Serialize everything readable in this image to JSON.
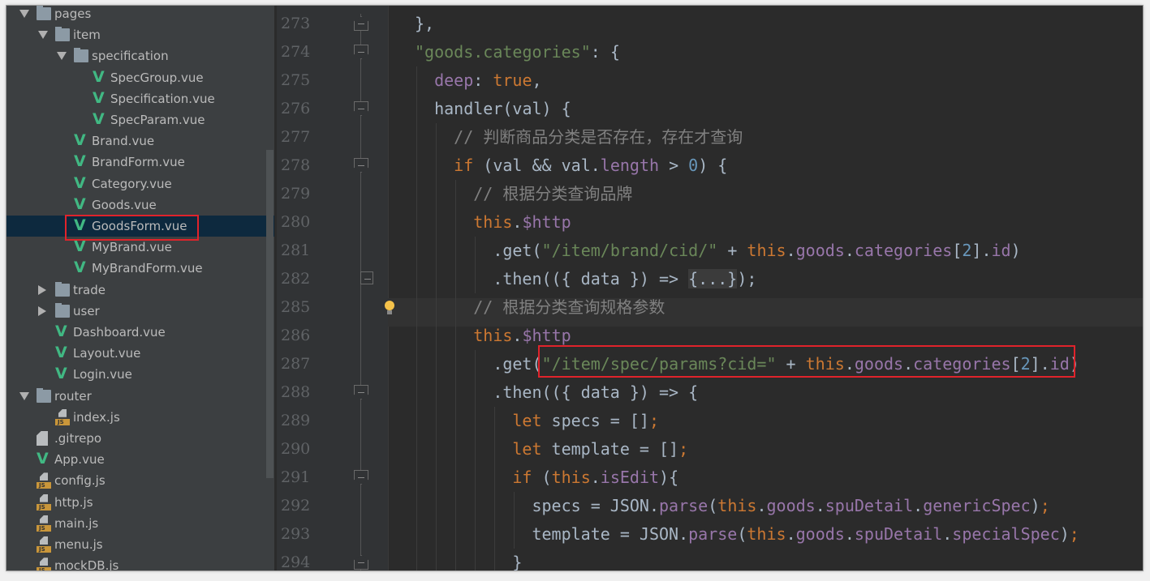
{
  "tree": [
    {
      "name": "pages",
      "type": "folder",
      "depth": 0,
      "expanded": true
    },
    {
      "name": "item",
      "type": "folder",
      "depth": 1,
      "expanded": true
    },
    {
      "name": "specification",
      "type": "folder",
      "depth": 2,
      "expanded": true
    },
    {
      "name": "SpecGroup.vue",
      "type": "vue",
      "depth": 3
    },
    {
      "name": "Specification.vue",
      "type": "vue",
      "depth": 3
    },
    {
      "name": "SpecParam.vue",
      "type": "vue",
      "depth": 3
    },
    {
      "name": "Brand.vue",
      "type": "vue",
      "depth": 2
    },
    {
      "name": "BrandForm.vue",
      "type": "vue",
      "depth": 2
    },
    {
      "name": "Category.vue",
      "type": "vue",
      "depth": 2
    },
    {
      "name": "Goods.vue",
      "type": "vue",
      "depth": 2
    },
    {
      "name": "GoodsForm.vue",
      "type": "vue",
      "depth": 2,
      "selected": true,
      "highlighted": true
    },
    {
      "name": "MyBrand.vue",
      "type": "vue",
      "depth": 2
    },
    {
      "name": "MyBrandForm.vue",
      "type": "vue",
      "depth": 2
    },
    {
      "name": "trade",
      "type": "folder",
      "depth": 1,
      "expanded": false
    },
    {
      "name": "user",
      "type": "folder",
      "depth": 1,
      "expanded": false
    },
    {
      "name": "Dashboard.vue",
      "type": "vue",
      "depth": 1
    },
    {
      "name": "Layout.vue",
      "type": "vue",
      "depth": 1
    },
    {
      "name": "Login.vue",
      "type": "vue",
      "depth": 1
    },
    {
      "name": "router",
      "type": "folder",
      "depth": 0,
      "expanded": true
    },
    {
      "name": "index.js",
      "type": "js",
      "depth": 1
    },
    {
      "name": ".gitrepo",
      "type": "text",
      "depth": 0
    },
    {
      "name": "App.vue",
      "type": "vue",
      "depth": 0
    },
    {
      "name": "config.js",
      "type": "js",
      "depth": 0
    },
    {
      "name": "http.js",
      "type": "js",
      "depth": 0
    },
    {
      "name": "main.js",
      "type": "js",
      "depth": 0
    },
    {
      "name": "menu.js",
      "type": "js",
      "depth": 0
    },
    {
      "name": "mockDB.js",
      "type": "js",
      "depth": 0
    }
  ],
  "js_badge": "JS",
  "highlight_color": "#e0232b",
  "code": [
    {
      "num": "273",
      "indent": 0,
      "fold": "end",
      "tokens": [
        [
          "t",
          "},"
        ]
      ]
    },
    {
      "num": "274",
      "indent": 0,
      "fold": "start",
      "tokens": [
        [
          "s",
          "\"goods.categories\""
        ],
        [
          "t",
          ": {"
        ]
      ]
    },
    {
      "num": "275",
      "indent": 2,
      "tokens": [
        [
          "p",
          "deep"
        ],
        [
          "t",
          ": "
        ],
        [
          "k",
          "true"
        ],
        [
          "t",
          ","
        ]
      ]
    },
    {
      "num": "276",
      "indent": 2,
      "fold": "start",
      "tokens": [
        [
          "t",
          "handler(val) {"
        ]
      ]
    },
    {
      "num": "277",
      "indent": 4,
      "tokens": [
        [
          "c",
          "// 判断商品分类是否存在，存在才查询"
        ]
      ]
    },
    {
      "num": "278",
      "indent": 4,
      "fold": "start",
      "tokens": [
        [
          "k",
          "if"
        ],
        [
          "t",
          " (val && val."
        ],
        [
          "p",
          "length"
        ],
        [
          "t",
          " > "
        ],
        [
          "n",
          "0"
        ],
        [
          "t",
          ") {"
        ]
      ]
    },
    {
      "num": "279",
      "indent": 6,
      "tokens": [
        [
          "c",
          "// 根据分类查询品牌"
        ]
      ]
    },
    {
      "num": "280",
      "indent": 6,
      "tokens": [
        [
          "k",
          "this"
        ],
        [
          "t",
          "."
        ],
        [
          "p",
          "$http"
        ]
      ]
    },
    {
      "num": "281",
      "indent": 8,
      "tokens": [
        [
          "t",
          ".get("
        ],
        [
          "s",
          "\"/item/brand/cid/\""
        ],
        [
          "t",
          " + "
        ],
        [
          "k",
          "this"
        ],
        [
          "t",
          "."
        ],
        [
          "p",
          "goods"
        ],
        [
          "t",
          "."
        ],
        [
          "p",
          "categories"
        ],
        [
          "t",
          "["
        ],
        [
          "n",
          "2"
        ],
        [
          "t",
          "]."
        ],
        [
          "p",
          "id"
        ],
        [
          "t",
          ")"
        ]
      ]
    },
    {
      "num": "282",
      "indent": 8,
      "fold": "collapsed",
      "tokens": [
        [
          "t",
          ".then(({ data }) => "
        ],
        [
          "fd",
          "{...}"
        ],
        [
          "t",
          ");"
        ]
      ]
    },
    {
      "num": "285",
      "indent": 6,
      "current": true,
      "tokens": [
        [
          "c",
          "// 根据分类查询规格参数"
        ]
      ]
    },
    {
      "num": "286",
      "indent": 6,
      "tokens": [
        [
          "k",
          "this"
        ],
        [
          "t",
          "."
        ],
        [
          "p",
          "$http"
        ]
      ]
    },
    {
      "num": "287",
      "indent": 8,
      "highlighted": true,
      "tokens": [
        [
          "t",
          ".get("
        ],
        [
          "s",
          "\"/item/spec/params?cid=\""
        ],
        [
          "t",
          " + "
        ],
        [
          "k",
          "this"
        ],
        [
          "t",
          "."
        ],
        [
          "p",
          "goods"
        ],
        [
          "t",
          "."
        ],
        [
          "p",
          "categories"
        ],
        [
          "t",
          "["
        ],
        [
          "n",
          "2"
        ],
        [
          "t",
          "]."
        ],
        [
          "p",
          "id"
        ],
        [
          "t",
          ")"
        ]
      ]
    },
    {
      "num": "288",
      "indent": 8,
      "fold": "start",
      "tokens": [
        [
          "t",
          ".then(({ data }) => {"
        ]
      ]
    },
    {
      "num": "289",
      "indent": 10,
      "tokens": [
        [
          "k",
          "let"
        ],
        [
          "t",
          " specs = []"
        ],
        [
          "k",
          ";"
        ]
      ]
    },
    {
      "num": "290",
      "indent": 10,
      "tokens": [
        [
          "k",
          "let"
        ],
        [
          "t",
          " template = []"
        ],
        [
          "k",
          ";"
        ]
      ]
    },
    {
      "num": "291",
      "indent": 10,
      "fold": "start",
      "tokens": [
        [
          "k",
          "if"
        ],
        [
          "t",
          " ("
        ],
        [
          "k",
          "this"
        ],
        [
          "t",
          "."
        ],
        [
          "p",
          "isEdit"
        ],
        [
          "t",
          "){"
        ]
      ]
    },
    {
      "num": "292",
      "indent": 12,
      "tokens": [
        [
          "t",
          "specs = JSON."
        ],
        [
          "p",
          "parse"
        ],
        [
          "t",
          "("
        ],
        [
          "k",
          "this"
        ],
        [
          "t",
          "."
        ],
        [
          "p",
          "goods"
        ],
        [
          "t",
          "."
        ],
        [
          "p",
          "spuDetail"
        ],
        [
          "t",
          "."
        ],
        [
          "p",
          "genericSpec"
        ],
        [
          "t",
          ")"
        ],
        [
          "k",
          ";"
        ]
      ]
    },
    {
      "num": "293",
      "indent": 12,
      "tokens": [
        [
          "t",
          "template = JSON."
        ],
        [
          "p",
          "parse"
        ],
        [
          "t",
          "("
        ],
        [
          "k",
          "this"
        ],
        [
          "t",
          "."
        ],
        [
          "p",
          "goods"
        ],
        [
          "t",
          "."
        ],
        [
          "p",
          "spuDetail"
        ],
        [
          "t",
          "."
        ],
        [
          "p",
          "specialSpec"
        ],
        [
          "t",
          ")"
        ],
        [
          "k",
          ";"
        ]
      ]
    },
    {
      "num": "294",
      "indent": 10,
      "fold": "end",
      "tokens": [
        [
          "t",
          "}"
        ]
      ]
    }
  ]
}
